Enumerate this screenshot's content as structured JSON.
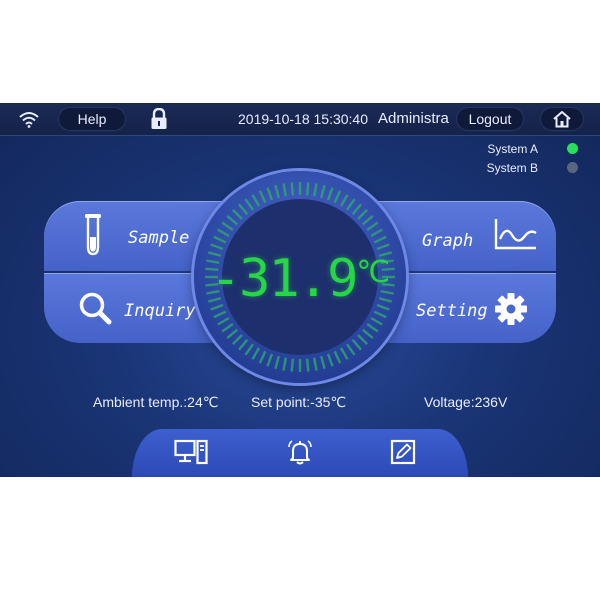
{
  "topbar": {
    "help_label": "Help",
    "datetime": "2019-10-18 15:30:40",
    "user": "Administra",
    "logout_label": "Logout"
  },
  "status": {
    "system_a_label": "System A",
    "system_a_color": "#27e05a",
    "system_b_label": "System B",
    "system_b_color": "#5a6680"
  },
  "menu": {
    "sample_label": "Sample",
    "inquiry_label": "Inquiry",
    "graph_label": "Graph",
    "setting_label": "Setting"
  },
  "readout": {
    "temperature": "-31.9",
    "unit": "℃",
    "color": "#27d646"
  },
  "info": {
    "ambient": "Ambient temp.:24℃",
    "set_point": "Set point:-35℃",
    "voltage": "Voltage:236V"
  },
  "icons": {
    "wifi": "wifi-icon",
    "lock": "lock-icon",
    "home": "home-icon",
    "sample": "test-tube-icon",
    "inquiry": "magnifier-icon",
    "graph": "line-graph-icon",
    "setting": "gear-icon",
    "monitor": "computer-monitor-icon",
    "alarm": "bell-icon",
    "edit": "edit-note-icon"
  }
}
